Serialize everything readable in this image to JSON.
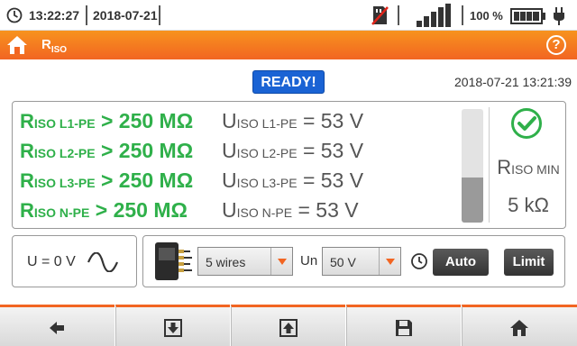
{
  "status": {
    "time": "13:22:27",
    "date": "2018-07-21",
    "battery_percent": "100 %",
    "signal_bars": 5,
    "icons": [
      "clock-icon",
      "sd-card-icon",
      "signal-icon",
      "battery-icon",
      "plug-icon"
    ]
  },
  "titlebar": {
    "title_main": "R",
    "title_sub": "ISO",
    "icons": [
      "home-icon",
      "help-icon"
    ],
    "help_label": "?"
  },
  "ready_label": "READY!",
  "datetime": "2018-07-21 13:21:39",
  "results": {
    "r_rows": [
      {
        "sym": "R",
        "sub": "ISO L1-PE",
        "val": "> 250 MΩ"
      },
      {
        "sym": "R",
        "sub": "ISO L2-PE",
        "val": "> 250 MΩ"
      },
      {
        "sym": "R",
        "sub": "ISO L3-PE",
        "val": "> 250 MΩ"
      },
      {
        "sym": "R",
        "sub": "ISO N-PE",
        "val": " > 250 MΩ"
      }
    ],
    "u_rows": [
      {
        "sym": "U",
        "sub": "ISO L1-PE",
        "val": "= 53 V"
      },
      {
        "sym": "U",
        "sub": "ISO L2-PE",
        "val": "= 53 V"
      },
      {
        "sym": "U",
        "sub": "ISO L3-PE",
        "val": "= 53 V"
      },
      {
        "sym": "U",
        "sub": "ISO N-PE",
        "val": " = 53 V"
      }
    ],
    "bar_level": 0.4,
    "rmin_sym": "R",
    "rmin_sub": "ISO MIN",
    "rmin_value": "5 kΩ",
    "status_color": "#2fb04a"
  },
  "voltage": {
    "text": "U = 0 V",
    "icon": "sine-wave-icon"
  },
  "controls": {
    "wires_value": "5 wires",
    "un_label": "Un",
    "un_value": "50 V",
    "auto_label": "Auto",
    "limit_label": "Limit"
  },
  "nav": [
    "arrow-left-icon",
    "save-down-icon",
    "upload-icon",
    "floppy-icon",
    "home-icon"
  ],
  "colors": {
    "accent": "#f26522",
    "ready_blue": "#1a63d4",
    "result_green": "#2fb04a"
  }
}
